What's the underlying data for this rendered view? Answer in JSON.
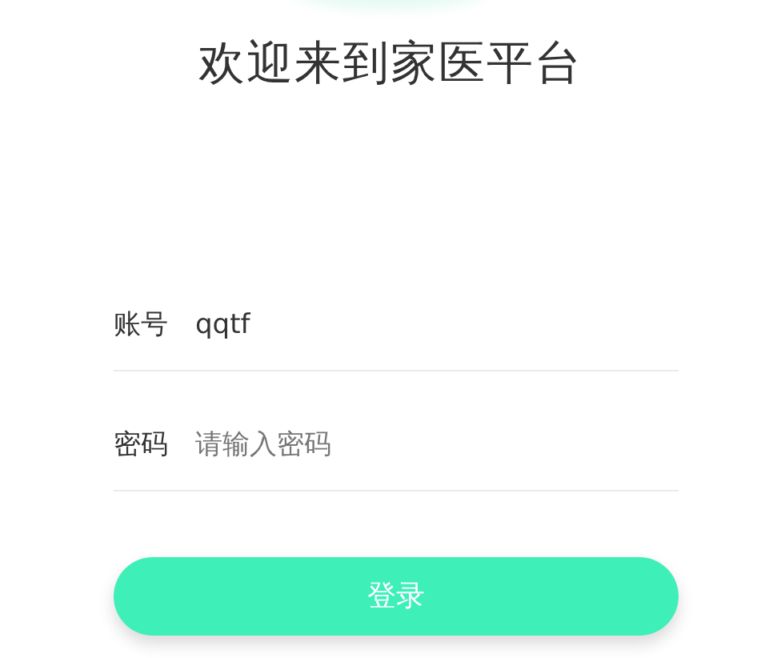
{
  "title": "欢迎来到家医平台",
  "fields": [
    {
      "label": "账号",
      "value": "qqtf"
    },
    {
      "label": "密码",
      "placeholder": "请输入密码"
    }
  ],
  "login_button": "登录"
}
